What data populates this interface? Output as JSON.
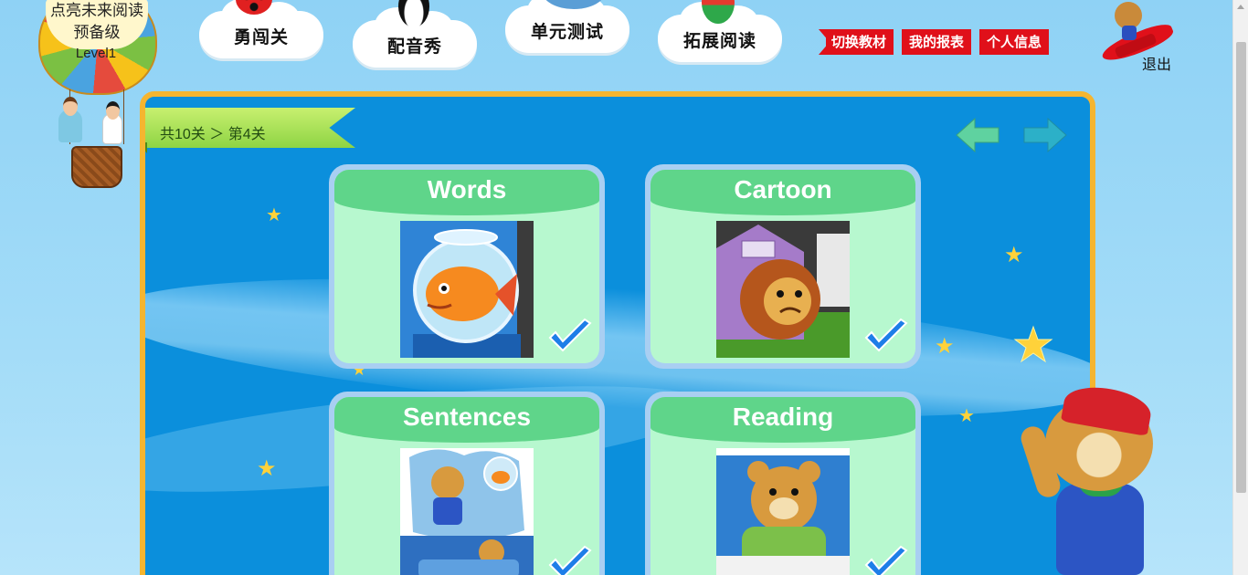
{
  "balloon": {
    "title_line1": "点亮未来阅读",
    "title_line2": "预备级",
    "level": "Level1"
  },
  "nav": {
    "items": [
      {
        "label": "勇闯关",
        "icon": "ladybug-icon"
      },
      {
        "label": "配音秀",
        "icon": "penguin-icon"
      },
      {
        "label": "单元测试",
        "icon": "elephant-icon"
      },
      {
        "label": "拓展阅读",
        "icon": "parrot-icon"
      }
    ]
  },
  "actions": {
    "switch_textbook": "切换教材",
    "my_report": "我的报表",
    "personal_info": "个人信息",
    "exit": "退出"
  },
  "breadcrumb": {
    "text": "共10关 ＞ 第4关"
  },
  "cards": [
    {
      "title": "Words",
      "image": "goldfish-in-bowl",
      "completed": true
    },
    {
      "title": "Cartoon",
      "image": "lion-leo-doghouse",
      "completed": true
    },
    {
      "title": "Sentences",
      "image": "bear-dreaming-of-fish",
      "completed": true
    },
    {
      "title": "Reading",
      "image": "bear-in-bed",
      "completed": true
    }
  ],
  "colors": {
    "board_bg": "#0b8fdc",
    "board_border": "#f5b530",
    "card_head": "#5fd58a",
    "card_body": "#b7f8cf",
    "action_red": "#e0101a",
    "ribbon_green": "#8ed444"
  }
}
